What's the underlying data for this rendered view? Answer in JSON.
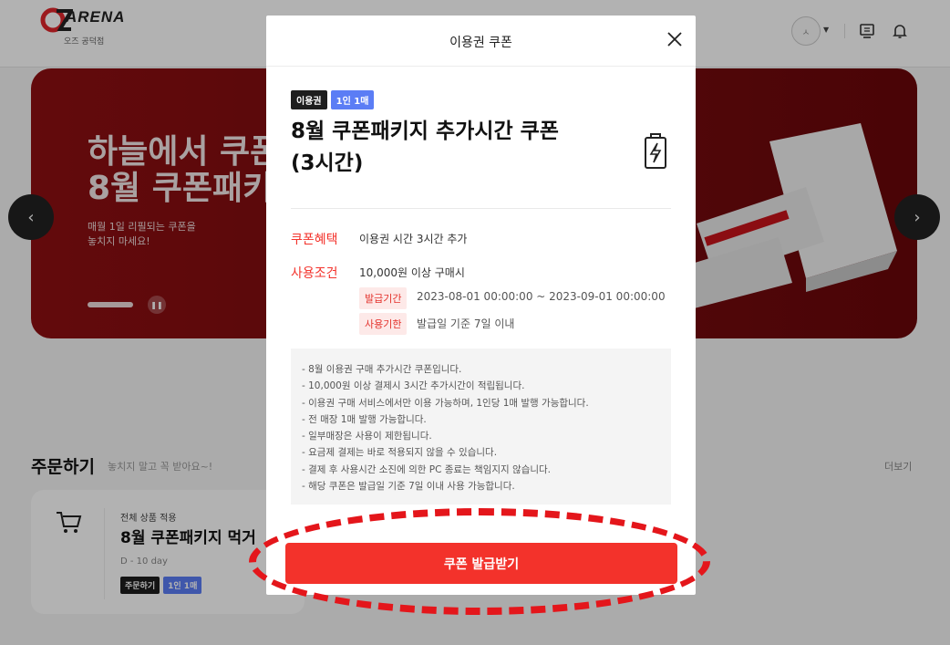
{
  "header": {
    "logo_text": "ARENA",
    "logo_sub": "오즈 공덕점"
  },
  "banner": {
    "title_line1": "하늘에서 쿠폰",
    "title_line2": "8월 쿠폰패키",
    "desc_line1": "매월 1일 리필되는 쿠폰을",
    "desc_line2": "놓치지 마세요!"
  },
  "order_section": {
    "title": "주문하기",
    "subtitle": "놓치지 말고 꼭 받아요~!",
    "more": "더보기",
    "card": {
      "scope": "전체 상품 적용",
      "title": "8월 쿠폰패키지 먹거",
      "dday": "D - 10 day",
      "tag1": "주문하기",
      "tag2": "1인 1매"
    }
  },
  "modal": {
    "title": "이용권 쿠폰",
    "badge_type": "이용권",
    "badge_limit": "1인 1매",
    "coupon_name_line1": "8월 쿠폰패키지 추가시간 쿠폰",
    "coupon_name_line2": "(3시간)",
    "benefit_label": "쿠폰혜택",
    "benefit_value": "이용권 시간 3시간 추가",
    "condition_label": "사용조건",
    "condition_value": "10,000원 이상 구매시",
    "issue_period_label": "발급기간",
    "issue_period_value": "2023-08-01 00:00:00 ~ 2023-09-01 00:00:00",
    "expiry_label": "사용기한",
    "expiry_value": "발급일 기준 7일 이내",
    "notes": [
      "- 8월 이용권 구매 추가시간 쿠폰입니다.",
      "- 10,000원 이상 결제시 3시간 추가시간이 적립됩니다.",
      "- 이용권 구매 서비스에서만 이용 가능하며, 1인당 1매 발행 가능합니다.",
      "- 전 매장 1매 발행 가능합니다.",
      "- 일부매장은 사용이 제한됩니다.",
      "- 요금제 결제는 바로 적용되지 않을 수 있습니다.",
      "- 결제 후 사용시간 소진에 의한 PC 종료는 책임지지 않습니다.",
      "- 해당 쿠폰은 발급일 기준 7일 이내 사용 가능합니다."
    ],
    "issue_button": "쿠폰 발급받기"
  },
  "colors": {
    "accent_red": "#f3322b",
    "badge_blue": "#5b7df5",
    "banner_red": "#8e0f12",
    "highlight_ring": "#e4161b"
  }
}
